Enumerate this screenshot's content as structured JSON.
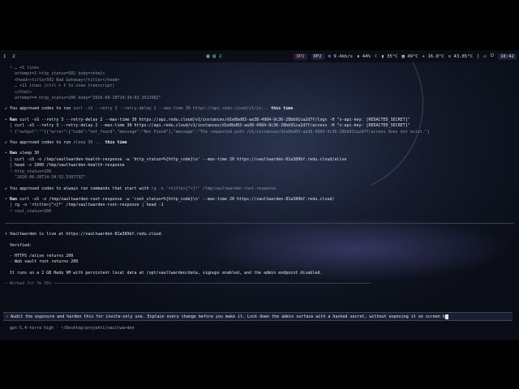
{
  "topbar": {
    "workspaces": [
      "1",
      "2"
    ],
    "tray_count": "2",
    "chips": [
      "DP2",
      "DP2"
    ],
    "network": "9.4kb/s",
    "volume": "44%",
    "moon_temp": "35°C",
    "temp2": "49°C",
    "temp3": "16.8°C",
    "temp4": "43.85°C",
    "time": "16:42"
  },
  "log": {
    "lines_collapsed": "… +5 lines",
    "attempt2": "attempt=2 http_status=502 body=<html>",
    "head_502": "<head><title>502 Bad Gateway</title></head>",
    "more_lines": "… +11 lines (ctrl + t to view transcript)",
    "html_close": "</html>",
    "attempt4": "attempt=4 http_status=200 body=\"2026-08-28T14:34:03.352348Z\"",
    "approved1_prefix": "You approved codex to run",
    "approved1_cmd": "curl -sS --retry 3 --retry-delay 2 --max-time 30 https://api.redu.cloud/v1/in...",
    "approved1_suffix": "this time",
    "ran1_label": "Ran",
    "ran1_cmd": "curl -sS --retry 3 --retry-delay 2 --max-time 30 https://api.redu.cloud/v1/instances/d1e0bd03-aa38-4984-9c36-28bb91ca2d7f/logs -H \"x-api-key: [REDACTED_SECRET]\"",
    "ran1_cmd2": "curl -sS --retry 3 --retry-delay 2 --max-time 30 https://api.redu.cloud/v1/instances/d1e0bd03-aa38-4984-9c36-28bb91ca2d7f/access -H \"x-api-key: [REDACTED_SECRET]\"",
    "ran1_out": "{\"output\":\"\"}{\"error\":{\"code\":\"not_found\",\"message\":\"Not Found\"},\"message\":\"The requested path /v1/instances/d1e0bd03-aa38-4984-9c36-28bb91ca2d7f/access does not exist.\"}",
    "approved2_prefix": "You approved codex to run",
    "approved2_cmd": "sleep 30 ...",
    "approved2_suffix": "this time",
    "ran2_label": "Ran",
    "ran2_cmd": "sleep 30",
    "ran2_l2": "curl -sS -o /tmp/vaultwarden-health-response -w 'http_status=%{http_code}\\n' --max-time 20 https://vaultwarden-81a389bf.redu.cloud/alive",
    "ran2_l3": "head -c 1000 /tmp/vaultwarden-health-response",
    "ran2_out1": "http_status=200",
    "ran2_out2": "\"2026-08-28T14:34:52.539773Z\"",
    "approved3_prefix": "You approved codex to always run commands that start with",
    "approved3_cmd": "rg -o '<title>[^<]*' /tmp/vaultwarden-root-response",
    "ran3_label": "Ran",
    "ran3_cmd": "curl -sS -o /tmp/vaultwarden-root-response -w 'root_status=%{http_code}\\n' --max-time 20 https://vaultwarden-81a389bf.redu.cloud/",
    "ran3_l2": "rg -o '<title>[^<]*' /tmp/vaultwarden-root-response | head -1",
    "ran3_out": "root_status=200"
  },
  "summary": {
    "live": "Vaultwarden is live at https://vaultwarden-81a389bf.redu.cloud",
    "verified": "Verified:",
    "item1": "- HTTPS /alive returns 200",
    "item2": "- Web vault root returns 200",
    "detail": "It runs on a 2 GB Redu VM with persistent local data at /opt/vaultwarden/data, signups enabled, and the admin endpoint disabled.",
    "worked": "Worked for 7m 50s"
  },
  "prompt": {
    "text": "Audit the exposure and harden this for invite-only use. Explain every change before you make it. Lock down the admin surface with a hashed secret, without exposing it on screen b"
  },
  "footer": {
    "model": "gpt-5.4-terra high",
    "path": "~/Desktop/projekti/vaultwarden"
  }
}
